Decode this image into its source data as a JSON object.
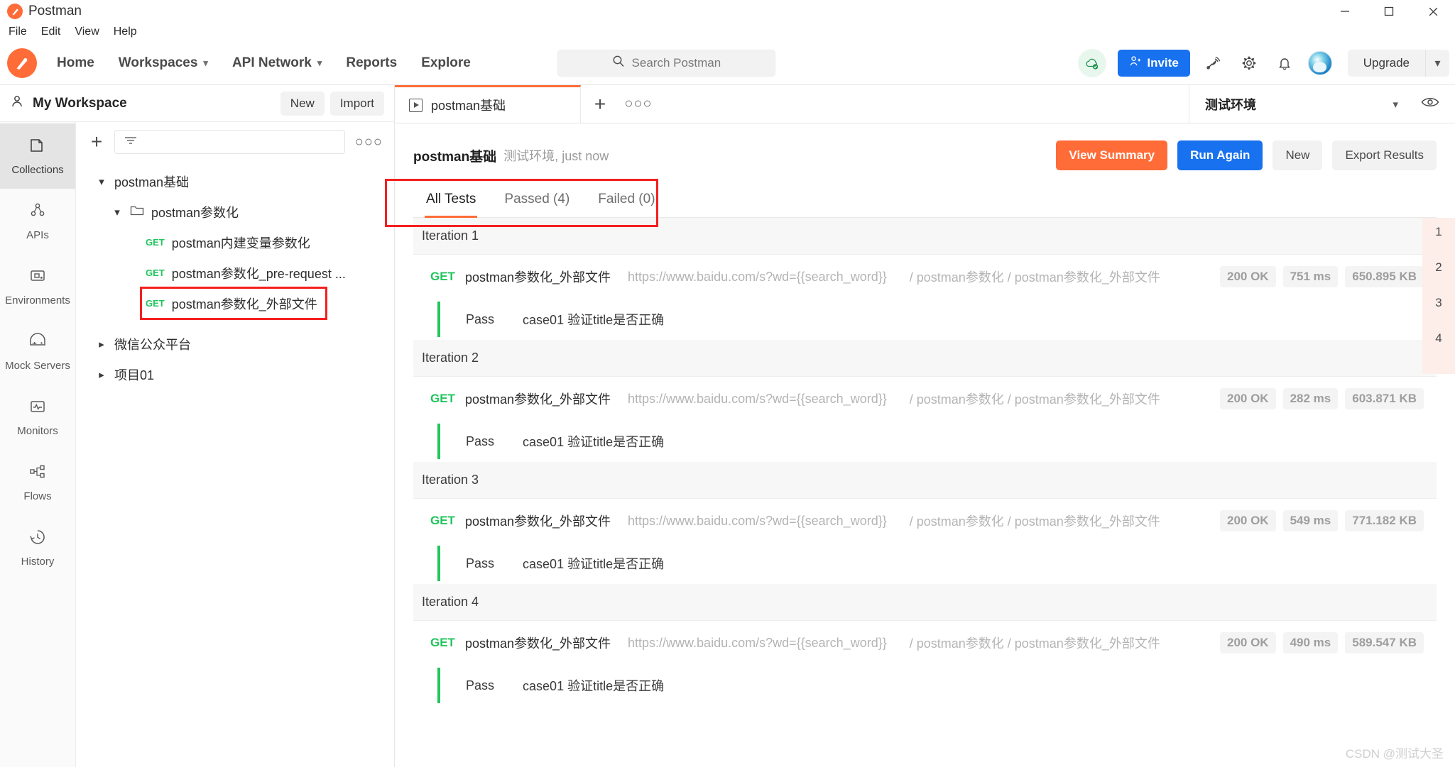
{
  "titlebar": {
    "app_title": "Postman",
    "window_buttons": [
      "minimize-icon",
      "maximize-icon",
      "close-icon"
    ]
  },
  "menubar": {
    "items": [
      "File",
      "Edit",
      "View",
      "Help"
    ]
  },
  "header": {
    "nav": [
      {
        "label": "Home",
        "caret": false
      },
      {
        "label": "Workspaces",
        "caret": true
      },
      {
        "label": "API Network",
        "caret": true
      },
      {
        "label": "Reports",
        "caret": false
      },
      {
        "label": "Explore",
        "caret": false
      }
    ],
    "search_placeholder": "Search Postman",
    "invite_label": "Invite",
    "upgrade_label": "Upgrade",
    "icons": [
      "cloud-sync-icon",
      "satellite-icon",
      "gear-icon",
      "bell-icon",
      "avatar"
    ]
  },
  "workspace": {
    "name": "My Workspace",
    "new_label": "New",
    "import_label": "Import"
  },
  "rail": {
    "items": [
      {
        "label": "Collections",
        "icon": "collections-icon",
        "active": true
      },
      {
        "label": "APIs",
        "icon": "apis-icon",
        "active": false
      },
      {
        "label": "Environments",
        "icon": "environments-icon",
        "active": false
      },
      {
        "label": "Mock Servers",
        "icon": "mock-servers-icon",
        "active": false
      },
      {
        "label": "Monitors",
        "icon": "monitors-icon",
        "active": false
      },
      {
        "label": "Flows",
        "icon": "flows-icon",
        "active": false
      },
      {
        "label": "History",
        "icon": "history-icon",
        "active": false
      }
    ]
  },
  "tree": {
    "filter_placeholder": "",
    "nodes": [
      {
        "label": "postman基础",
        "level": 0,
        "twisty": "down",
        "kind": "collection"
      },
      {
        "label": "postman参数化",
        "level": 1,
        "twisty": "down",
        "kind": "folder"
      },
      {
        "label": "postman内建变量参数化",
        "level": 2,
        "twisty": "none",
        "kind": "request",
        "method": "GET"
      },
      {
        "label": "postman参数化_pre-request ...",
        "level": 2,
        "twisty": "none",
        "kind": "request",
        "method": "GET"
      },
      {
        "label": "postman参数化_外部文件",
        "level": 2,
        "twisty": "none",
        "kind": "request",
        "method": "GET",
        "highlight": true
      },
      {
        "label": "微信公众平台",
        "level": 0,
        "twisty": "right",
        "kind": "collection"
      },
      {
        "label": "项目01",
        "level": 0,
        "twisty": "right",
        "kind": "collection"
      }
    ]
  },
  "tabbar": {
    "runner_tab_label": "postman基础",
    "add_label": "+",
    "more_label": "●●●",
    "environment": "测试环境"
  },
  "run": {
    "title": "postman基础",
    "subtitle": "测试环境, just now",
    "buttons": {
      "view_summary": "View Summary",
      "run_again": "Run Again",
      "new": "New",
      "export_results": "Export Results"
    },
    "result_tabs": [
      {
        "label": "All Tests",
        "active": true
      },
      {
        "label": "Passed (4)",
        "active": false
      },
      {
        "label": "Failed (0)",
        "active": false
      }
    ],
    "iteration_strip": [
      "1",
      "2",
      "3",
      "4"
    ],
    "iterations": [
      {
        "title": "Iteration 1",
        "request": {
          "method": "GET",
          "name": "postman参数化_外部文件",
          "url": "https://www.baidu.com/s?wd={{search_word}}",
          "path": "/ postman参数化 / postman参数化_外部文件",
          "status": "200 OK",
          "time": "751 ms",
          "size": "650.895 KB"
        },
        "assertion": {
          "status": "Pass",
          "text": "case01 验证title是否正确"
        }
      },
      {
        "title": "Iteration 2",
        "request": {
          "method": "GET",
          "name": "postman参数化_外部文件",
          "url": "https://www.baidu.com/s?wd={{search_word}}",
          "path": "/ postman参数化 / postman参数化_外部文件",
          "status": "200 OK",
          "time": "282 ms",
          "size": "603.871 KB"
        },
        "assertion": {
          "status": "Pass",
          "text": "case01 验证title是否正确"
        }
      },
      {
        "title": "Iteration 3",
        "request": {
          "method": "GET",
          "name": "postman参数化_外部文件",
          "url": "https://www.baidu.com/s?wd={{search_word}}",
          "path": "/ postman参数化 / postman参数化_外部文件",
          "status": "200 OK",
          "time": "549 ms",
          "size": "771.182 KB"
        },
        "assertion": {
          "status": "Pass",
          "text": "case01 验证title是否正确"
        }
      },
      {
        "title": "Iteration 4",
        "request": {
          "method": "GET",
          "name": "postman参数化_外部文件",
          "url": "https://www.baidu.com/s?wd={{search_word}}",
          "path": "/ postman参数化 / postman参数化_外部文件",
          "status": "200 OK",
          "time": "490 ms",
          "size": "589.547 KB"
        },
        "assertion": {
          "status": "Pass",
          "text": "case01 验证title是否正确"
        }
      }
    ]
  },
  "watermark": "CSDN @测试大圣",
  "colors": {
    "accent_orange": "#ff6c37",
    "accent_blue": "#1871ef",
    "pass_green": "#22c55e",
    "highlight_red": "#f4201f"
  }
}
